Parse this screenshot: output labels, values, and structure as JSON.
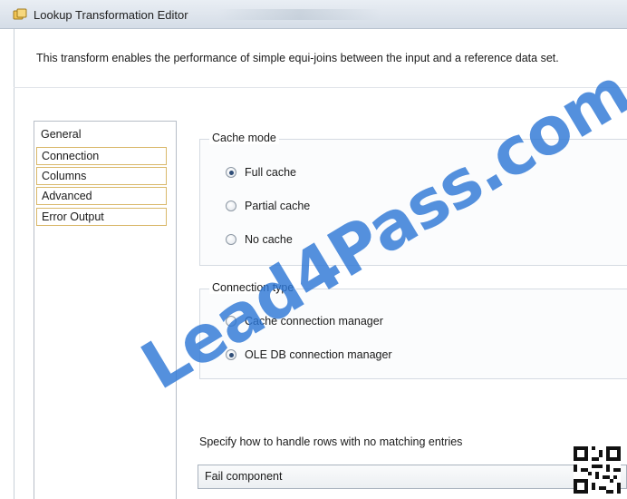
{
  "window": {
    "title": "Lookup Transformation Editor"
  },
  "header": {
    "description": "This transform enables the performance of simple equi-joins between the input and a reference data set."
  },
  "nav": {
    "items": [
      {
        "label": "General"
      },
      {
        "label": "Connection"
      },
      {
        "label": "Columns"
      },
      {
        "label": "Advanced"
      },
      {
        "label": "Error Output"
      }
    ]
  },
  "cache_mode": {
    "legend": "Cache mode",
    "options": [
      {
        "label": "Full cache",
        "selected": true
      },
      {
        "label": "Partial cache",
        "selected": false
      },
      {
        "label": "No cache",
        "selected": false
      }
    ]
  },
  "connection_type": {
    "legend": "Connection type",
    "options": [
      {
        "label": "Cache connection manager",
        "selected": false
      },
      {
        "label": "OLE DB connection manager",
        "selected": true
      }
    ]
  },
  "no_match": {
    "label": "Specify how to handle rows with no matching entries",
    "selected_value": "Fail component"
  },
  "watermark": {
    "text": "Lead4Pass.com",
    "color": "#2e78d6"
  },
  "icons": {
    "app": "lookup-transform-icon",
    "qr": "qr-code-icon"
  }
}
